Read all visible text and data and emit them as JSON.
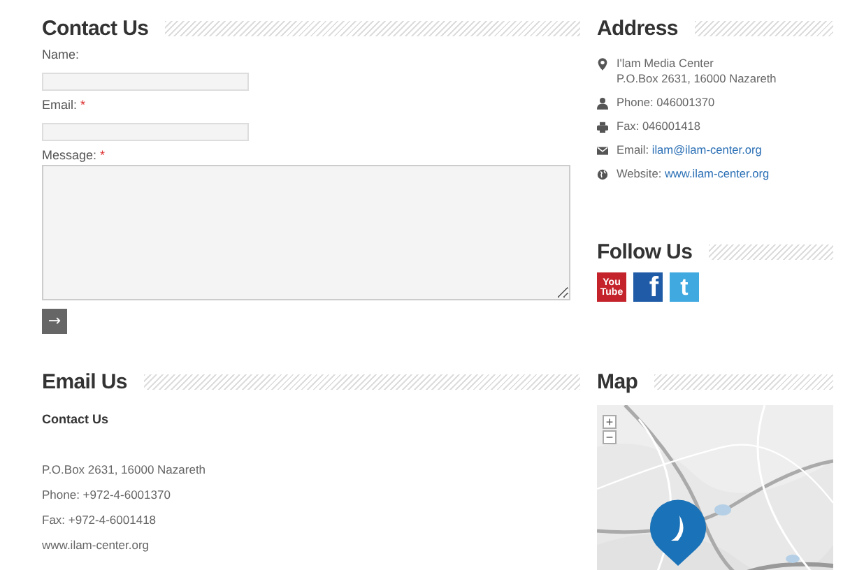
{
  "contact": {
    "title": "Contact Us",
    "fields": [
      {
        "label": "Name:",
        "kind": "input"
      },
      {
        "label": "Email:",
        "required_mark": "*",
        "kind": "input"
      },
      {
        "label": "Message:",
        "required_mark": "*",
        "kind": "textarea"
      }
    ],
    "submit": "→"
  },
  "address": {
    "title": "Address",
    "items": [
      {
        "kind": "pin",
        "lines": [
          "I'lam Media Center",
          "P.O.Box 2631, 16000 Nazareth"
        ]
      },
      {
        "kind": "person",
        "lines": [
          "Phone: 046001370"
        ]
      },
      {
        "kind": "printer",
        "lines": [
          "Fax: 046001418"
        ]
      },
      {
        "kind": "mail",
        "lines": [
          "Email: "
        ],
        "link": "ilam@ilam-center.org"
      },
      {
        "kind": "globe",
        "lines": [
          "Website: "
        ],
        "link": "www.ilam-center.org"
      }
    ]
  },
  "follow": {
    "title": "Follow Us",
    "icons": [
      {
        "kind": "youtube",
        "lines": [
          "You",
          "Tube"
        ]
      },
      {
        "kind": "facebook",
        "lines": [
          "f"
        ]
      },
      {
        "kind": "twitter",
        "lines": [
          "t"
        ]
      }
    ]
  },
  "email": {
    "title": "Email Us",
    "heading": "Contact Us",
    "lines": [
      "P.O.Box 2631, 16000 Nazareth",
      "Phone: +972-4-6001370",
      "Fax: +972-4-6001418",
      "www.ilam-center.org"
    ]
  },
  "map": {
    "title": "Map",
    "zoom_in": "+",
    "zoom_out": "−"
  }
}
